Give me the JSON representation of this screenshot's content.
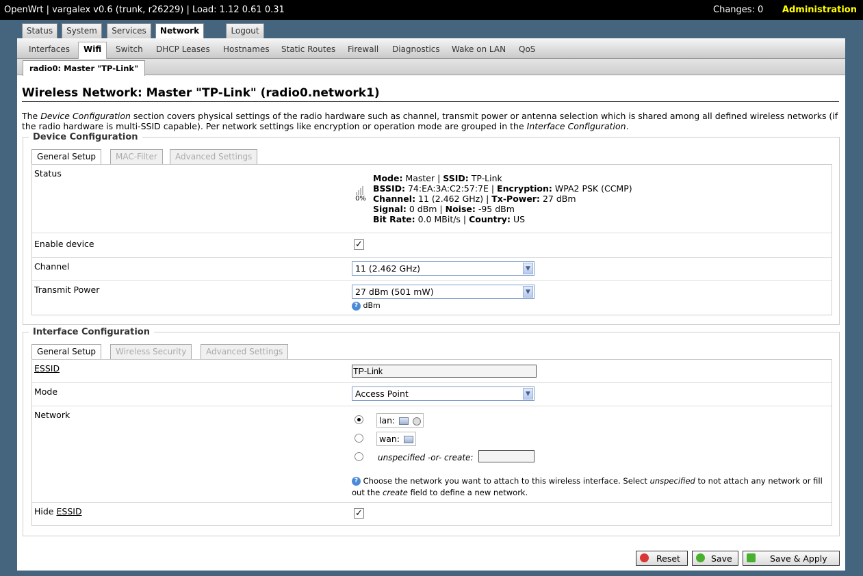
{
  "topbar": {
    "title": "OpenWrt | vargalex v0.6 (trunk, r26229) | Load: 1.12 0.61 0.31",
    "changes": "Changes: 0",
    "admin": "Administration"
  },
  "maintabs": [
    "Status",
    "System",
    "Services",
    "Network",
    "Logout"
  ],
  "submenu": [
    "Interfaces",
    "Wifi",
    "Switch",
    "DHCP Leases",
    "Hostnames",
    "Static Routes",
    "Firewall",
    "Diagnostics",
    "Wake on LAN",
    "QoS"
  ],
  "radiotab": "radio0: Master \"TP-Link\"",
  "page": {
    "title": "Wireless Network: Master \"TP-Link\" (radio0.network1)",
    "desc_1": "The ",
    "desc_em1": "Device Configuration",
    "desc_2": " section covers physical settings of the radio hardware such as channel, transmit power or antenna selection which is shared among all defined wireless networks (if the radio hardware is multi-SSID capable). Per network settings like encryption or operation mode are grouped in the ",
    "desc_em2": "Interface Configuration",
    "desc_3": "."
  },
  "device": {
    "legend": "Device Configuration",
    "tabs": [
      "General Setup",
      "MAC-Filter",
      "Advanced Settings"
    ],
    "status_label": "Status",
    "signal_pct": "0%",
    "status": {
      "mode_k": "Mode:",
      "mode_v": " Master | ",
      "ssid_k": "SSID:",
      "ssid_v": " TP-Link",
      "bssid_k": "BSSID:",
      "bssid_v": " 74:EA:3A:C2:57:7E | ",
      "enc_k": "Encryption:",
      "enc_v": " WPA2 PSK (CCMP)",
      "chan_k": "Channel:",
      "chan_v": " 11 (2.462 GHz) | ",
      "tx_k": "Tx-Power:",
      "tx_v": " 27 dBm",
      "sig_k": "Signal:",
      "sig_v": " 0 dBm | ",
      "noise_k": "Noise:",
      "noise_v": " -95 dBm",
      "rate_k": "Bit Rate:",
      "rate_v": " 0.0 MBit/s | ",
      "country_k": "Country:",
      "country_v": " US"
    },
    "enable_label": "Enable device",
    "channel_label": "Channel",
    "channel_value": "11 (2.462 GHz)",
    "txpower_label": "Transmit Power",
    "txpower_value": "27 dBm (501 mW)",
    "txpower_hint": "dBm"
  },
  "iface": {
    "legend": "Interface Configuration",
    "tabs": [
      "General Setup",
      "Wireless Security",
      "Advanced Settings"
    ],
    "essid_label": "ESSID",
    "essid_value": "TP-Link",
    "mode_label": "Mode",
    "mode_value": "Access Point",
    "network_label": "Network",
    "net_lan": "lan:",
    "net_wan": "wan:",
    "net_unspec": "unspecified -or- create:",
    "net_hint_1": "Choose the network you want to attach to this wireless interface. Select ",
    "net_hint_em1": "unspecified",
    "net_hint_2": " to not attach any network or fill out the ",
    "net_hint_em2": "create",
    "net_hint_3": " field to define a new network.",
    "hide_label_1": "Hide ",
    "hide_label_2": "ESSID"
  },
  "buttons": {
    "reset": "Reset",
    "save": "Save",
    "apply": "Save & Apply"
  }
}
